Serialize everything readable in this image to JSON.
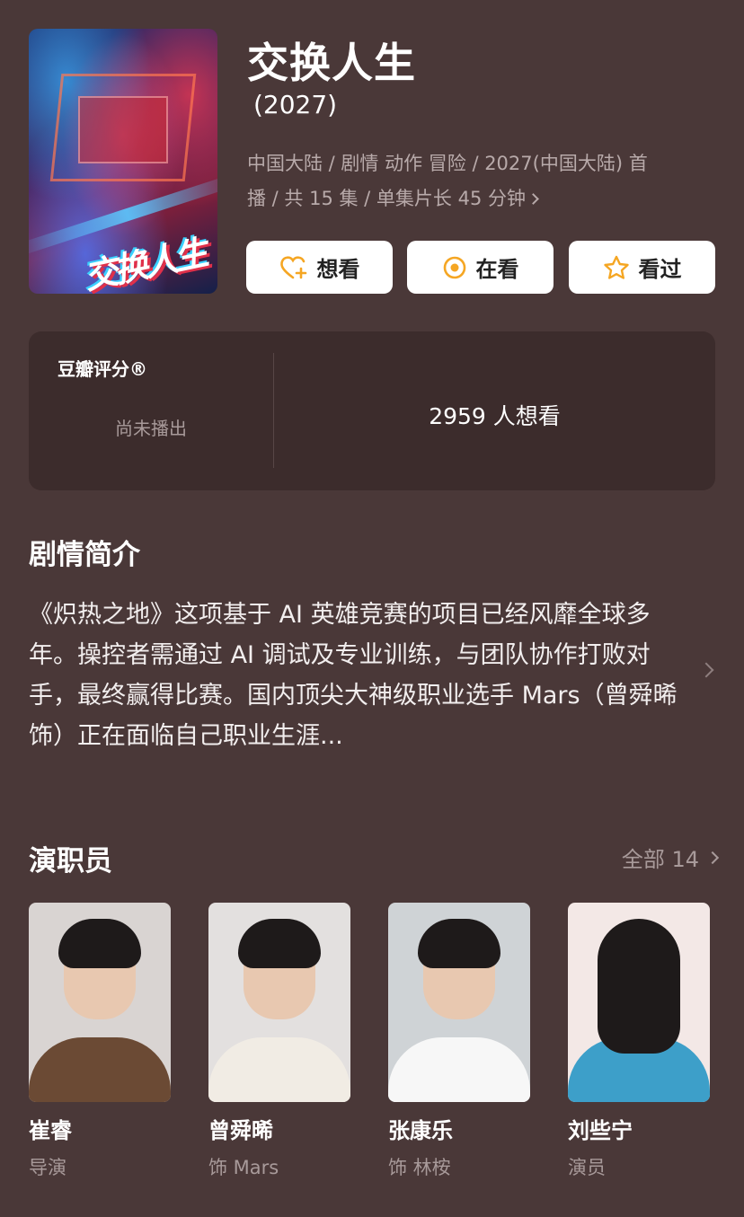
{
  "show": {
    "title": "交换人生",
    "year": "(2027)",
    "meta_line1": "中国大陆 / 剧情 动作 冒险 / 2027(中国大陆) 首",
    "meta_line2": "播 / 共 15 集 / 单集片长 45 分钟",
    "poster_text": "交换人生"
  },
  "actions": {
    "want_label": "想看",
    "watching_label": "在看",
    "watched_label": "看过",
    "accent_color": "#f5a623"
  },
  "rating": {
    "label": "豆瓣评分®",
    "status": "尚未播出",
    "want_count": "2959 人想看"
  },
  "synopsis": {
    "title": "剧情简介",
    "text": "《炽热之地》这项基于 AI 英雄竞赛的项目已经风靡全球多年。操控者需通过 AI 调试及专业训练，与团队协作打败对手，最终赢得比赛。国内顶尖大神级职业选手 Mars（曾舜晞 饰）正在面临自己职业生涯..."
  },
  "cast": {
    "title": "演职员",
    "all_label": "全部 14",
    "members": [
      {
        "name": "崔睿",
        "role": "导演"
      },
      {
        "name": "曾舜晞",
        "role": "饰 Mars"
      },
      {
        "name": "张康乐",
        "role": "饰 林桉"
      },
      {
        "name": "刘些宁",
        "role": "演员"
      }
    ]
  }
}
